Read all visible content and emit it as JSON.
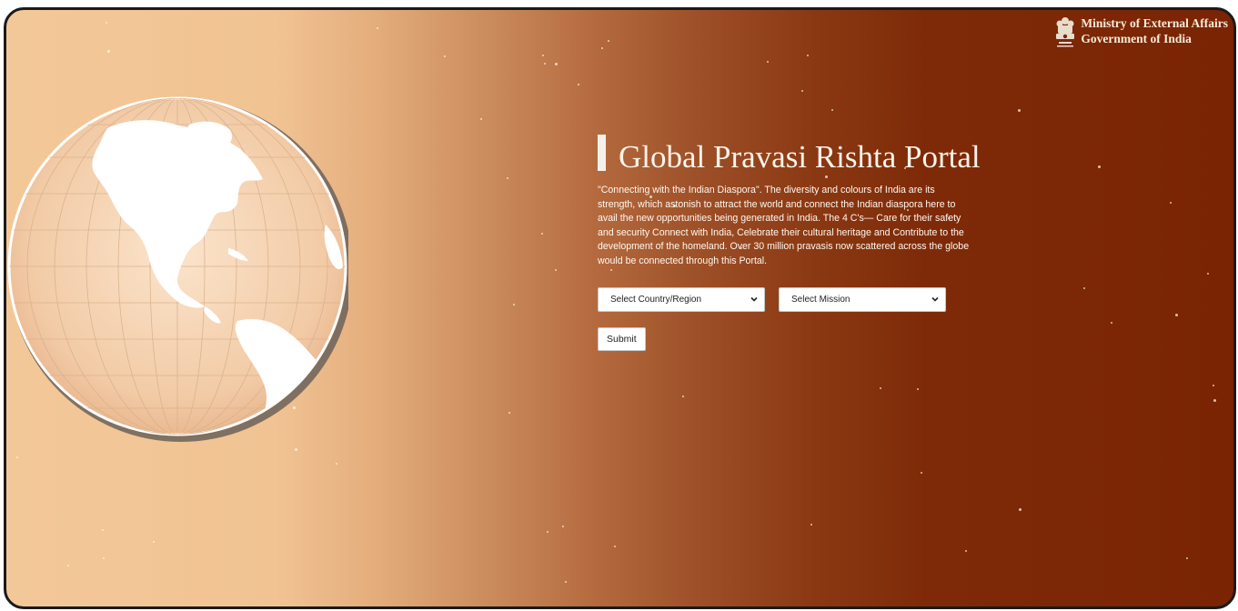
{
  "header": {
    "ministry_line1": "Ministry of External Affairs",
    "ministry_line2": "Government of India",
    "emblem_icon": "national-emblem-icon"
  },
  "hero": {
    "title": "Global Pravasi Rishta Portal",
    "description": "\"Connecting with the Indian Diaspora\". The diversity and colours of India are its strength, which astonish to attract the world and connect the Indian diaspora here to avail the new opportunities being generated in India. The 4 C's— Care for their safety and security Connect with India, Celebrate their cultural heritage and Contribute to the development of the homeland. Over 30 million pravasis now scattered across the globe would be connected through this Portal."
  },
  "form": {
    "country_select": "Select Country/Region",
    "mission_select": "Select Mission",
    "submit_label": "Submit"
  },
  "colors": {
    "gradient_light": "#f3c898",
    "gradient_dark": "#7a2404",
    "text_light": "#fbf3ea"
  }
}
